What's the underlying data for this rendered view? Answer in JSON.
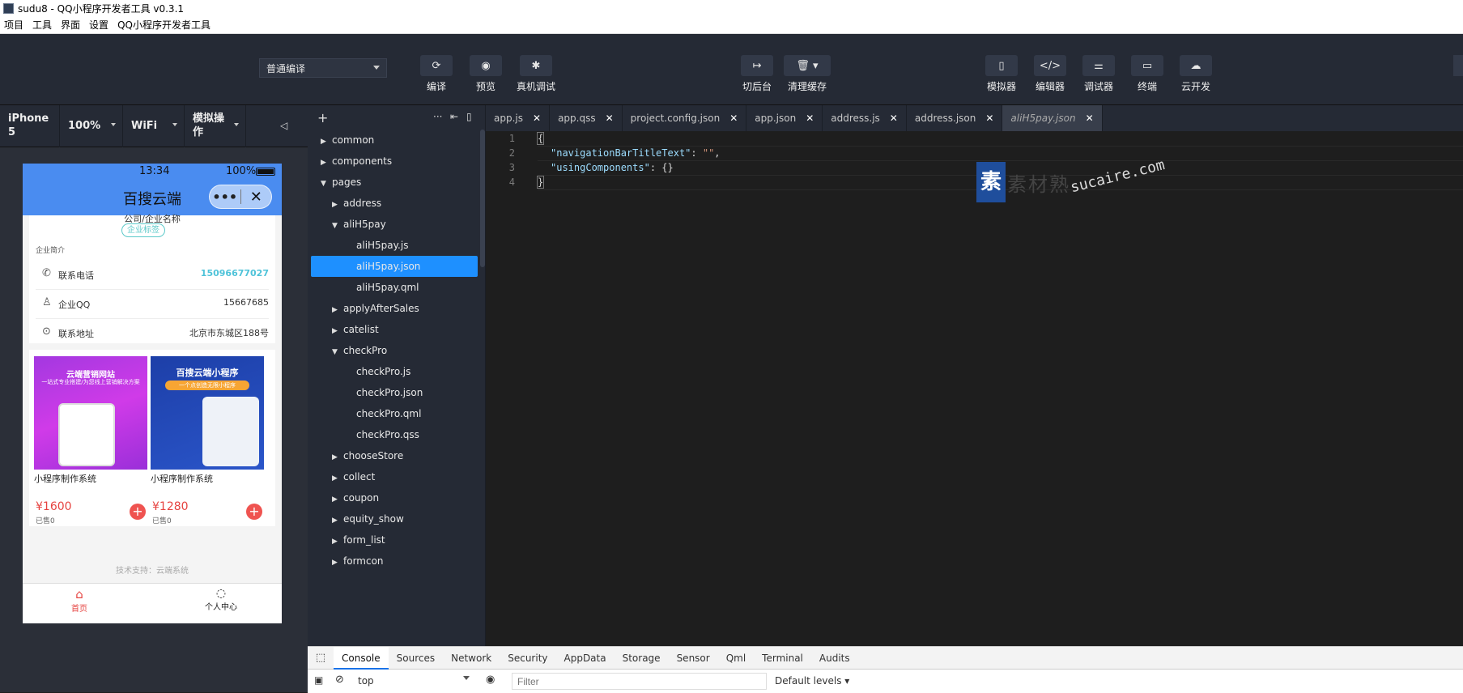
{
  "window": {
    "title": "sudu8 - QQ小程序开发者工具 v0.3.1"
  },
  "menu": [
    "项目",
    "工具",
    "界面",
    "设置",
    "QQ小程序开发者工具"
  ],
  "toolbar": {
    "compile_mode": "普通编译",
    "buttons": [
      {
        "label": "编译",
        "icon": "refresh-icon"
      },
      {
        "label": "预览",
        "icon": "eye-icon"
      },
      {
        "label": "真机调试",
        "icon": "bug-icon"
      },
      {
        "label": "切后台",
        "icon": "switch-icon"
      },
      {
        "label": "清理缓存",
        "icon": "trash-icon"
      },
      {
        "label": "模拟器",
        "icon": "phone-icon"
      },
      {
        "label": "编辑器",
        "icon": "code-icon"
      },
      {
        "label": "调试器",
        "icon": "sliders-icon"
      },
      {
        "label": "终端",
        "icon": "terminal-icon"
      },
      {
        "label": "云开发",
        "icon": "cloud-icon"
      }
    ]
  },
  "device_bar": {
    "device": "iPhone 5",
    "zoom": "100%",
    "network": "WiFi",
    "operation": "模拟操作"
  },
  "phone": {
    "time": "13:34",
    "battery": "100%",
    "nav_title": "百搜云端",
    "company_name": "公司/企业名称",
    "company_badge": "企业标签",
    "intro_label": "企业简介",
    "rows": [
      {
        "key": "联系电话",
        "value": "15096677027",
        "icon": "phone-icon"
      },
      {
        "key": "企业QQ",
        "value": "15667685",
        "icon": "qq-icon"
      },
      {
        "key": "联系地址",
        "value": "北京市东城区188号",
        "icon": "location-icon"
      }
    ],
    "products": [
      {
        "name": "小程序制作系统",
        "price": "¥1600",
        "sold": "已售0",
        "banner": "云端营销网站",
        "banner_sub": "一站式专业搭建/为您线上营销解决方案"
      },
      {
        "name": "小程序制作系统",
        "price": "¥1280",
        "sold": "已售0",
        "banner": "百搜云端小程序",
        "banner_sub": "一个点创造无限小程序"
      }
    ],
    "footer": "技术支持：云端系统",
    "tabs": [
      {
        "label": "首页",
        "icon": "home-icon"
      },
      {
        "label": "个人中心",
        "icon": "user-icon"
      }
    ]
  },
  "tree": [
    {
      "label": "common",
      "depth": 0,
      "arrow": "right"
    },
    {
      "label": "components",
      "depth": 0,
      "arrow": "right"
    },
    {
      "label": "pages",
      "depth": 0,
      "arrow": "down"
    },
    {
      "label": "address",
      "depth": 1,
      "arrow": "right"
    },
    {
      "label": "aliH5pay",
      "depth": 1,
      "arrow": "down"
    },
    {
      "label": "aliH5pay.js",
      "depth": 2,
      "arrow": ""
    },
    {
      "label": "aliH5pay.json",
      "depth": 2,
      "arrow": "",
      "selected": true
    },
    {
      "label": "aliH5pay.qml",
      "depth": 2,
      "arrow": ""
    },
    {
      "label": "applyAfterSales",
      "depth": 1,
      "arrow": "right"
    },
    {
      "label": "catelist",
      "depth": 1,
      "arrow": "right"
    },
    {
      "label": "checkPro",
      "depth": 1,
      "arrow": "down"
    },
    {
      "label": "checkPro.js",
      "depth": 2,
      "arrow": ""
    },
    {
      "label": "checkPro.json",
      "depth": 2,
      "arrow": ""
    },
    {
      "label": "checkPro.qml",
      "depth": 2,
      "arrow": ""
    },
    {
      "label": "checkPro.qss",
      "depth": 2,
      "arrow": ""
    },
    {
      "label": "chooseStore",
      "depth": 1,
      "arrow": "right"
    },
    {
      "label": "collect",
      "depth": 1,
      "arrow": "right"
    },
    {
      "label": "coupon",
      "depth": 1,
      "arrow": "right"
    },
    {
      "label": "equity_show",
      "depth": 1,
      "arrow": "right"
    },
    {
      "label": "form_list",
      "depth": 1,
      "arrow": "right"
    },
    {
      "label": "formcon",
      "depth": 1,
      "arrow": "right"
    }
  ],
  "editor_tabs": [
    "app.js",
    "app.qss",
    "project.config.json",
    "app.json",
    "address.js",
    "address.json",
    "aliH5pay.json"
  ],
  "code": {
    "line_numbers": [
      "1",
      "2",
      "3",
      "4"
    ],
    "open": "{",
    "k1": "\"navigationBarTitleText\"",
    "v1": "\"\"",
    "k2": "\"usingComponents\"",
    "v2": "{}",
    "close": "}"
  },
  "watermark": {
    "cn": "素材熟",
    "en": "sucaire.com"
  },
  "devtools": {
    "tabs": [
      "Console",
      "Sources",
      "Network",
      "Security",
      "AppData",
      "Storage",
      "Sensor",
      "Qml",
      "Terminal",
      "Audits"
    ],
    "context": "top",
    "filter_placeholder": "Filter",
    "levels": "Default levels ▾"
  }
}
